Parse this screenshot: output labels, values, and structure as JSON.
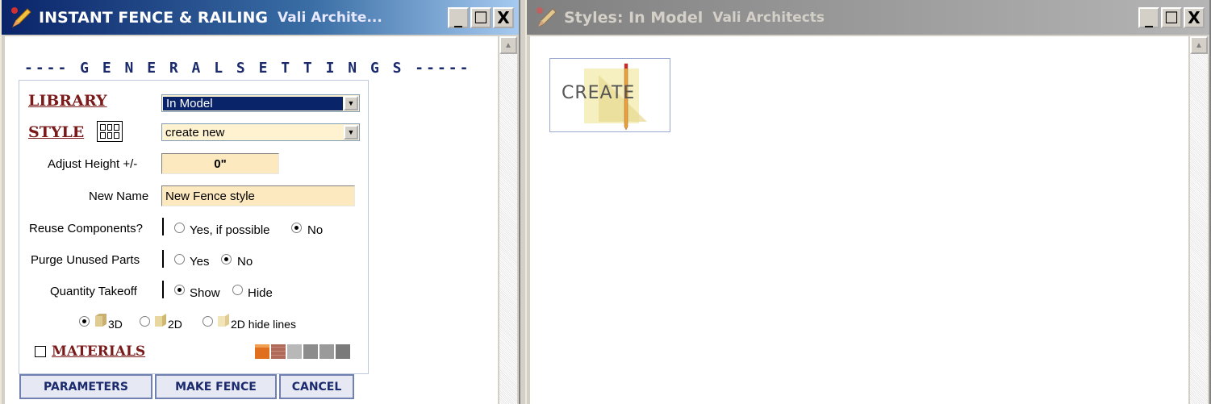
{
  "left_window": {
    "title": "INSTANT FENCE & RAILING",
    "subtitle": "Vali Archite...",
    "heading": "---- G E N E R A L   S E T T I N G S -----",
    "library": {
      "label": "LIBRARY",
      "value": "In Model"
    },
    "style": {
      "label": "STYLE",
      "value": "create new"
    },
    "adjust_height": {
      "label": "Adjust Height +/-",
      "value": "0\""
    },
    "new_name": {
      "label": "New Name",
      "value": "New Fence style"
    },
    "reuse_components": {
      "label": "Reuse Components?",
      "option_yes": "Yes, if possible",
      "option_no": "No",
      "selected": "No"
    },
    "purge_unused": {
      "label": "Purge Unused Parts",
      "option_yes": "Yes",
      "option_no": "No",
      "selected": "No"
    },
    "quantity_takeoff": {
      "label": "Quantity Takeoff",
      "option_show": "Show",
      "option_hide": "Hide",
      "selected": "Show"
    },
    "view_mode": {
      "option_3d": "3D",
      "option_2d": "2D",
      "option_2d_hide": "2D hide lines",
      "selected": "3D"
    },
    "materials": {
      "label": "MATERIALS",
      "checked": false,
      "swatches": [
        "#e07020",
        "#b06a5a",
        "#b8b8b8",
        "#8c8c8c",
        "#9a9a9a"
      ]
    },
    "buttons": {
      "parameters": "PARAMETERS",
      "make_fence": "MAKE FENCE",
      "cancel": "CANCEL"
    }
  },
  "right_window": {
    "title": "Styles: In Model",
    "subtitle": "Vali Architects",
    "thumbnail_label": "CREATE"
  },
  "titlebar_buttons": {
    "minimize": "_",
    "maximize": "☐",
    "close": "X"
  },
  "colors": {
    "active_title": "#0a246a",
    "label_accent": "#7a1a1a",
    "heading": "#1a2a6c",
    "field_fill": "#fde9c0"
  }
}
